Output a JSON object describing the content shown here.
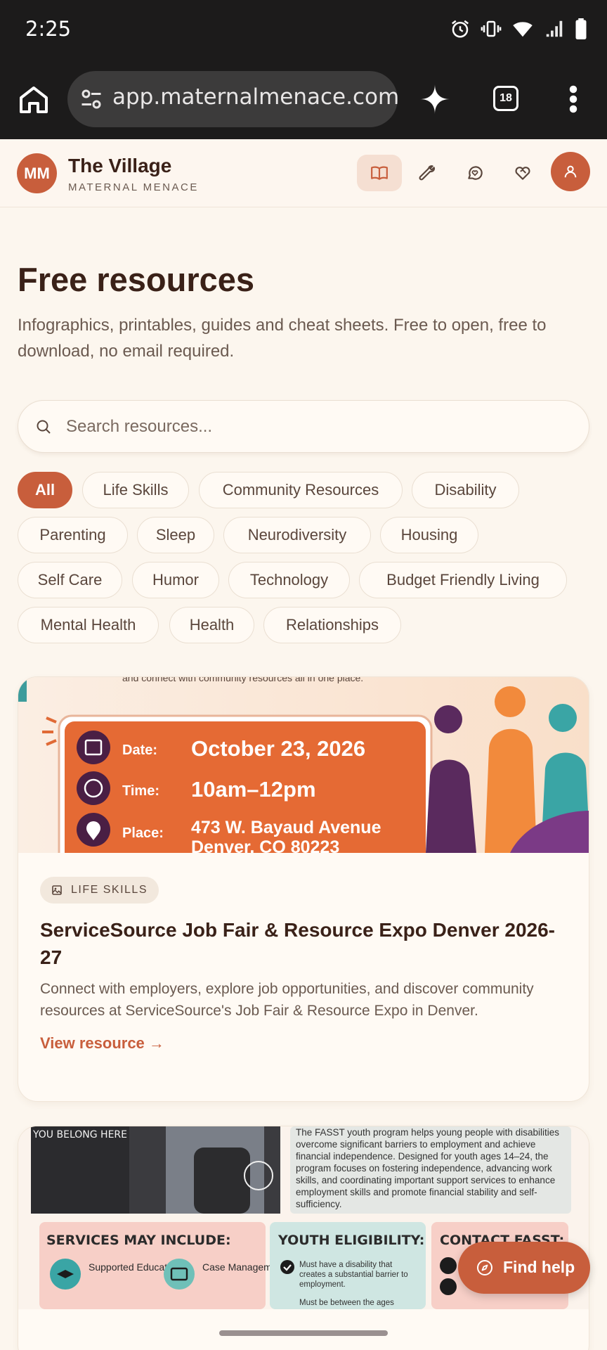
{
  "status": {
    "time": "2:25"
  },
  "browser": {
    "url": "app.maternalmenace.com/r",
    "tab_count": "18"
  },
  "header": {
    "logo_initials": "MM",
    "title": "The Village",
    "subtitle": "MATERNAL MENACE"
  },
  "page": {
    "title": "Free resources",
    "intro": "Infographics, printables, guides and cheat sheets. Free to open, free to download, no email required.",
    "search_placeholder": "Search resources..."
  },
  "filters": [
    "All",
    "Life Skills",
    "Community Resources",
    "Disability",
    "Parenting",
    "Sleep",
    "Neurodiversity",
    "Housing",
    "Self Care",
    "Humor",
    "Technology",
    "Budget Friendly Living",
    "Mental Health",
    "Health",
    "Relationships"
  ],
  "cards": [
    {
      "image_text": {
        "top": "and connect with community resources all in one place.",
        "date_label": "Date:",
        "date": "October 23, 2026",
        "time_label": "Time:",
        "time": "10am–12pm",
        "place_label": "Place:",
        "place1": "473 W. Bayaud Avenue",
        "place2": "Denver, CO 80223"
      },
      "tag": "LIFE SKILLS",
      "title": "ServiceSource Job Fair & Resource Expo Denver 2026-27",
      "description": "Connect with employers, explore job opportunities, and discover community resources at ServiceSource's Job Fair & Resource Expo in Denver.",
      "link": "View resource →"
    },
    {
      "image_text": {
        "belong": "YOU BELONG HERE",
        "blurb": "The FASST youth program helps young people with disabilities overcome significant barriers to employment and achieve financial independence. Designed for youth ages 14–24, the program focuses on fostering independence, advancing work skills, and coordinating important support services to enhance employment skills and promote financial stability and self-sufficiency.",
        "services": "SERVICES MAY INCLUDE:",
        "svc1": "Supported Education",
        "svc2": "Case Management",
        "eligibility": "YOUTH ELIGIBILITY:",
        "elig1": "Must have a disability that creates a substantial barrier to employment.",
        "elig2": "Must be between the ages",
        "contact": "CONTACT FASST:"
      }
    }
  ],
  "find_help": "Find help"
}
